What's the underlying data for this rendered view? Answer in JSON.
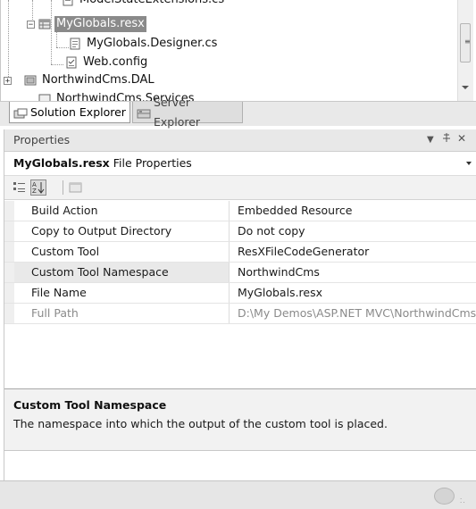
{
  "solution_explorer": {
    "items": [
      {
        "label": "ModelStateExtensions.cs",
        "partial": true
      },
      {
        "label": "MyGlobals.resx",
        "selected": true
      },
      {
        "label": "MyGlobals.Designer.cs"
      },
      {
        "label": "Web.config"
      },
      {
        "label": "NorthwindCms.DAL"
      },
      {
        "label": "NorthwindCms.Services",
        "partial": true
      }
    ]
  },
  "tabs": [
    {
      "label": "Solution Explorer",
      "icon": "solution-explorer-icon",
      "active": true
    },
    {
      "label": "Server Explorer",
      "icon": "server-explorer-icon",
      "active": false
    }
  ],
  "properties": {
    "title": "Properties",
    "pin_glyph": "ᅮ",
    "close_glyph": "✕",
    "object_name": "MyGlobals.resx",
    "object_kind": "File Properties",
    "rows": [
      {
        "name": "Build Action",
        "value": "Embedded Resource"
      },
      {
        "name": "Copy to Output Directory",
        "value": "Do not copy"
      },
      {
        "name": "Custom Tool",
        "value": "ResXFileCodeGenerator"
      },
      {
        "name": "Custom Tool Namespace",
        "value": "NorthwindCms",
        "highlighted": true
      },
      {
        "name": "File Name",
        "value": "MyGlobals.resx"
      },
      {
        "name": "Full Path",
        "value": "D:\\My Demos\\ASP.NET MVC\\NorthwindCms",
        "muted": true
      }
    ],
    "description_title": "Custom Tool Namespace",
    "description_text": "The namespace into which the output of the custom tool is placed."
  },
  "colors": {
    "selection": "#8a8a8a",
    "panel_bg": "#f2f2f2"
  }
}
